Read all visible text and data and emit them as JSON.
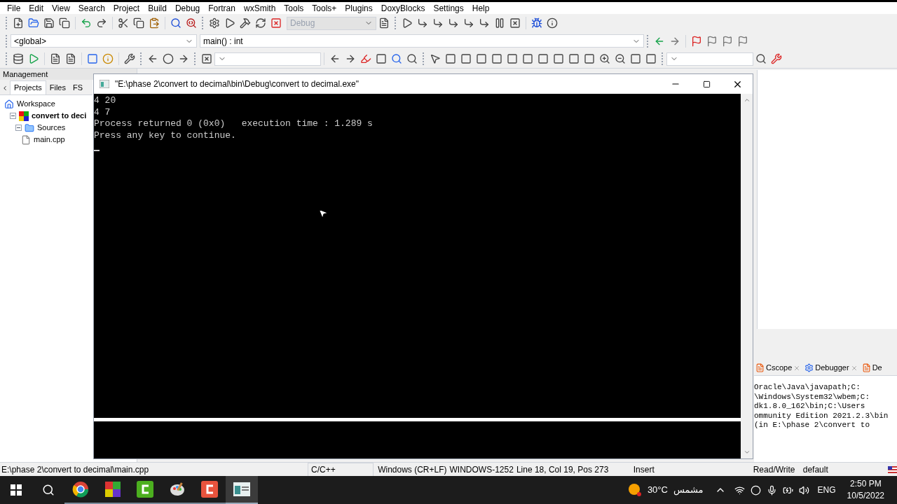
{
  "menu": [
    "File",
    "Edit",
    "View",
    "Search",
    "Project",
    "Build",
    "Debug",
    "Fortran",
    "wxSmith",
    "Tools",
    "Tools+",
    "Plugins",
    "DoxyBlocks",
    "Settings",
    "Help"
  ],
  "toolbar": {
    "build_target": {
      "value": "Debug",
      "disabled": true
    },
    "scope": {
      "value": "<global>"
    },
    "function": {
      "value": "main() : int"
    }
  },
  "management": {
    "title": "Management",
    "tabs": [
      {
        "label": "Projects",
        "selected": true
      },
      {
        "label": "Files",
        "selected": false
      },
      {
        "label": "FS",
        "selected": false
      }
    ],
    "tree": [
      {
        "label": "Workspace",
        "kind": "workspace",
        "children": [
          {
            "label": "convert to deci",
            "kind": "project",
            "children": [
              {
                "label": "Sources",
                "kind": "folder",
                "children": [
                  {
                    "label": "main.cpp",
                    "kind": "file"
                  }
                ]
              }
            ]
          }
        ]
      }
    ]
  },
  "console": {
    "title": "\"E:\\phase 2\\convert to decimal\\bin\\Debug\\convert to decimal.exe\"",
    "lines": [
      "4 20",
      "4 7",
      "Process returned 0 (0x0)   execution time : 1.289 s",
      "Press any key to continue."
    ]
  },
  "logs": {
    "tabs": [
      {
        "label": "Cscope",
        "selected": false
      },
      {
        "label": "Debugger",
        "selected": false
      },
      {
        "label": "De",
        "selected": false
      }
    ],
    "lines": [
      "Oracle\\Java\\javapath;C:",
      "\\Windows\\System32\\wbem;C:",
      "dk1.8.0_162\\bin;C:\\Users",
      "ommunity Edition 2021.2.3\\bin",
      "(in E:\\phase 2\\convert to"
    ]
  },
  "status_bar": [
    "E:\\phase 2\\convert to decimal\\main.cpp",
    "C/C++",
    "Windows (CR+LF)",
    "WINDOWS-1252",
    "Line 18, Col 19, Pos 273",
    "Insert",
    "Read/Write",
    "default"
  ],
  "taskbar": {
    "apps": [
      {
        "kind": "chrome",
        "selected": false
      },
      {
        "kind": "blocks",
        "selected": false
      },
      {
        "kind": "green-c",
        "selected": false
      },
      {
        "kind": "paint",
        "selected": false
      },
      {
        "kind": "red-c",
        "selected": false
      },
      {
        "kind": "console",
        "selected": true
      }
    ],
    "weather": {
      "temperature": "30°C",
      "condition": "مشمس"
    },
    "language": "ENG",
    "time": "2:50 PM",
    "date": "10/5/2022"
  }
}
